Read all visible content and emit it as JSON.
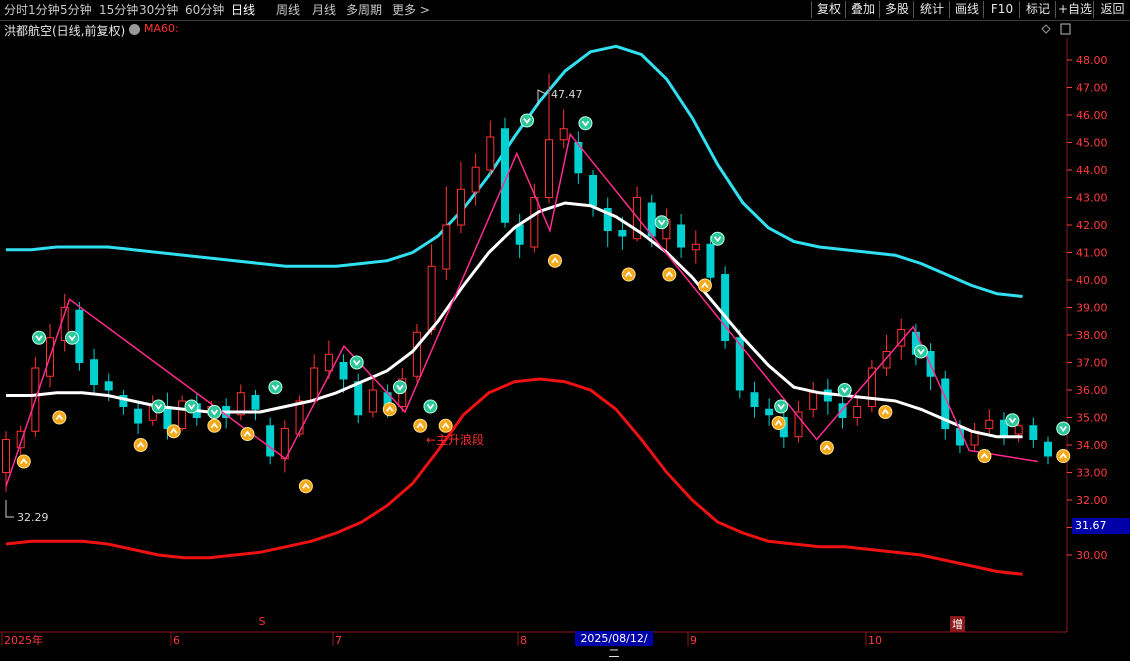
{
  "toolbar": {
    "periods": [
      "分时",
      "1分钟",
      "5分钟",
      "15分钟",
      "30分钟",
      "60分钟",
      "日线",
      "周线",
      "月线",
      "多周期",
      "更多 >"
    ],
    "active_period": "日线",
    "actions": [
      "复权",
      "叠加",
      "多股",
      "统计",
      "画线",
      "F10",
      "标记",
      "+自选",
      "返回"
    ]
  },
  "info": {
    "title": "洪都航空(日线,前复权)",
    "indicator": "MA60:"
  },
  "colors": {
    "up": "#ff3232",
    "down": "#00d0d0",
    "upper_band": "#30e0f0",
    "lower_band": "#ee1111",
    "mid_line": "#ffffff",
    "zigzag": "#ff2b8e",
    "axis_text": "#ff3c3c",
    "grid": "#8b1a1a"
  },
  "chart_data": {
    "type": "candlestick",
    "y_axis_ticks": [
      48.0,
      47.0,
      46.0,
      45.0,
      44.0,
      43.0,
      42.0,
      41.0,
      40.0,
      39.0,
      38.0,
      37.0,
      36.0,
      35.0,
      34.0,
      33.0,
      32.0,
      31.0,
      30.0
    ],
    "ylim": [
      29.5,
      49.0
    ],
    "x_axis_labels": [
      "2025年",
      "6",
      "7",
      "8",
      "9",
      "10"
    ],
    "high_label": "47.47",
    "low_label": "32.29",
    "current_price": "31.67",
    "cursor_date": "2025/08/12/二",
    "annotation": "←主升浪段",
    "marker_s": "S",
    "badge_zeng": "增",
    "upper_band": [
      41.1,
      41.1,
      41.2,
      41.2,
      41.2,
      41.1,
      41.0,
      40.9,
      40.8,
      40.7,
      40.6,
      40.5,
      40.5,
      40.5,
      40.6,
      40.7,
      41.0,
      41.6,
      42.6,
      43.8,
      45.2,
      46.5,
      47.6,
      48.3,
      48.5,
      48.2,
      47.3,
      45.9,
      44.2,
      42.8,
      41.9,
      41.4,
      41.2,
      41.1,
      41.0,
      40.9,
      40.6,
      40.2,
      39.8,
      39.5,
      39.4
    ],
    "mid_line": [
      35.8,
      35.8,
      35.9,
      35.9,
      35.8,
      35.6,
      35.4,
      35.3,
      35.2,
      35.2,
      35.2,
      35.4,
      35.6,
      35.9,
      36.3,
      36.7,
      37.4,
      38.5,
      39.8,
      41.0,
      41.9,
      42.5,
      42.8,
      42.7,
      42.3,
      41.7,
      41.0,
      40.1,
      39.0,
      37.9,
      36.9,
      36.1,
      35.9,
      35.8,
      35.7,
      35.6,
      35.3,
      34.9,
      34.5,
      34.3,
      34.3
    ],
    "lower_band": [
      30.4,
      30.5,
      30.5,
      30.5,
      30.4,
      30.2,
      30.0,
      29.9,
      29.9,
      30.0,
      30.1,
      30.3,
      30.5,
      30.8,
      31.2,
      31.8,
      32.6,
      33.8,
      35.1,
      35.9,
      36.3,
      36.4,
      36.3,
      36.0,
      35.3,
      34.2,
      33.0,
      32.0,
      31.2,
      30.8,
      30.5,
      30.4,
      30.3,
      30.3,
      30.2,
      30.1,
      30.0,
      29.8,
      29.6,
      29.4,
      29.3
    ],
    "zigzag": [
      [
        0,
        32.5
      ],
      [
        2.5,
        39.3
      ],
      [
        11.0,
        33.5
      ],
      [
        13.3,
        37.6
      ],
      [
        15.7,
        35.2
      ],
      [
        20.1,
        44.6
      ],
      [
        21.4,
        41.8
      ],
      [
        22.2,
        45.3
      ],
      [
        31.9,
        34.2
      ],
      [
        35.7,
        38.3
      ],
      [
        37.9,
        33.8
      ],
      [
        40.6,
        33.4
      ]
    ],
    "sell_markers": [
      [
        1.3,
        37.9
      ],
      [
        2.6,
        37.9
      ],
      [
        6.0,
        35.4
      ],
      [
        7.3,
        35.4
      ],
      [
        8.2,
        35.2
      ],
      [
        10.6,
        36.1
      ],
      [
        13.8,
        37.0
      ],
      [
        15.5,
        36.1
      ],
      [
        16.7,
        35.4
      ],
      [
        20.5,
        45.8
      ],
      [
        22.8,
        45.7
      ],
      [
        25.8,
        42.1
      ],
      [
        28.0,
        41.5
      ],
      [
        30.5,
        35.4
      ],
      [
        33.0,
        36.0
      ],
      [
        36.0,
        37.4
      ],
      [
        39.6,
        34.9
      ],
      [
        41.6,
        34.6
      ]
    ],
    "buy_markers": [
      [
        0.7,
        33.4
      ],
      [
        2.1,
        35.0
      ],
      [
        5.3,
        34.0
      ],
      [
        6.6,
        34.5
      ],
      [
        8.2,
        34.7
      ],
      [
        9.5,
        34.4
      ],
      [
        11.8,
        32.5
      ],
      [
        15.1,
        35.3
      ],
      [
        16.3,
        34.7
      ],
      [
        17.3,
        34.7
      ],
      [
        21.6,
        40.7
      ],
      [
        24.5,
        40.2
      ],
      [
        26.1,
        40.2
      ],
      [
        27.5,
        39.8
      ],
      [
        30.4,
        34.8
      ],
      [
        32.3,
        33.9
      ],
      [
        34.6,
        35.2
      ],
      [
        38.5,
        33.6
      ],
      [
        41.6,
        33.6
      ]
    ],
    "candles": [
      [
        33.0,
        34.2,
        34.5,
        32.3
      ],
      [
        33.9,
        34.5,
        34.7,
        33.6
      ],
      [
        34.5,
        36.8,
        37.2,
        34.3
      ],
      [
        36.5,
        37.9,
        38.4,
        36.1
      ],
      [
        37.8,
        39.0,
        39.5,
        37.4
      ],
      [
        38.9,
        37.0,
        39.2,
        36.7
      ],
      [
        37.1,
        36.2,
        37.5,
        35.9
      ],
      [
        36.3,
        36.0,
        36.6,
        35.6
      ],
      [
        35.8,
        35.4,
        36.0,
        35.1
      ],
      [
        35.3,
        34.8,
        35.6,
        34.4
      ],
      [
        34.9,
        35.5,
        35.8,
        34.7
      ],
      [
        35.4,
        34.6,
        35.9,
        34.2
      ],
      [
        34.6,
        35.6,
        35.8,
        34.5
      ],
      [
        35.5,
        35.0,
        35.9,
        34.7
      ],
      [
        35.1,
        35.4,
        35.6,
        34.8
      ],
      [
        35.4,
        35.0,
        35.7,
        34.6
      ],
      [
        35.1,
        35.9,
        36.2,
        34.9
      ],
      [
        35.8,
        35.3,
        36.0,
        34.9
      ],
      [
        34.7,
        33.6,
        35.0,
        33.3
      ],
      [
        33.5,
        34.6,
        34.9,
        33.0
      ],
      [
        34.4,
        35.6,
        35.8,
        34.3
      ],
      [
        35.6,
        36.8,
        37.3,
        35.5
      ],
      [
        36.7,
        37.3,
        37.8,
        36.4
      ],
      [
        37.0,
        36.4,
        37.3,
        35.9
      ],
      [
        36.3,
        35.1,
        36.6,
        34.8
      ],
      [
        35.2,
        36.0,
        36.5,
        35.0
      ],
      [
        35.9,
        35.3,
        36.2,
        35.0
      ],
      [
        35.4,
        36.4,
        36.8,
        35.2
      ],
      [
        36.5,
        38.1,
        38.4,
        36.3
      ],
      [
        38.2,
        40.5,
        41.3,
        38.0
      ],
      [
        40.4,
        42.0,
        43.4,
        40.0
      ],
      [
        42.0,
        43.3,
        44.3,
        41.7
      ],
      [
        43.2,
        44.1,
        44.6,
        42.7
      ],
      [
        44.0,
        45.2,
        45.8,
        43.8
      ],
      [
        45.5,
        42.1,
        45.9,
        41.9
      ],
      [
        42.0,
        41.3,
        42.4,
        40.8
      ],
      [
        41.2,
        43.0,
        43.5,
        41.0
      ],
      [
        43.0,
        45.1,
        47.5,
        42.8
      ],
      [
        45.1,
        45.5,
        46.2,
        44.8
      ],
      [
        45.0,
        43.9,
        45.4,
        43.5
      ],
      [
        43.8,
        42.7,
        44.0,
        42.3
      ],
      [
        42.6,
        41.8,
        43.0,
        41.2
      ],
      [
        41.8,
        41.6,
        42.3,
        41.1
      ],
      [
        41.5,
        43.0,
        43.4,
        41.4
      ],
      [
        42.8,
        41.6,
        43.1,
        41.2
      ],
      [
        41.5,
        42.2,
        42.6,
        41.0
      ],
      [
        42.0,
        41.2,
        42.4,
        40.8
      ],
      [
        41.1,
        41.3,
        41.8,
        40.6
      ],
      [
        41.3,
        40.1,
        41.6,
        39.8
      ],
      [
        40.2,
        37.8,
        40.5,
        37.5
      ],
      [
        37.9,
        36.0,
        38.2,
        35.7
      ],
      [
        35.9,
        35.4,
        36.3,
        35.0
      ],
      [
        35.3,
        35.1,
        35.7,
        34.7
      ],
      [
        35.0,
        34.3,
        35.4,
        33.9
      ],
      [
        34.3,
        35.2,
        35.6,
        34.1
      ],
      [
        35.3,
        35.9,
        36.3,
        35.0
      ],
      [
        36.0,
        35.6,
        36.4,
        35.1
      ],
      [
        35.5,
        35.0,
        35.9,
        34.6
      ],
      [
        35.0,
        35.4,
        35.8,
        34.7
      ],
      [
        35.4,
        36.8,
        37.1,
        35.2
      ],
      [
        36.8,
        37.4,
        38.0,
        36.5
      ],
      [
        37.6,
        38.2,
        38.6,
        37.1
      ],
      [
        38.1,
        37.3,
        38.4,
        36.9
      ],
      [
        37.4,
        36.5,
        37.7,
        36.0
      ],
      [
        36.4,
        34.6,
        36.7,
        34.2
      ],
      [
        34.6,
        34.0,
        34.9,
        33.7
      ],
      [
        34.0,
        34.5,
        34.8,
        33.8
      ],
      [
        34.6,
        34.9,
        35.3,
        34.3
      ],
      [
        34.9,
        34.3,
        35.2,
        34.0
      ],
      [
        34.4,
        34.7,
        35.0,
        34.1
      ],
      [
        34.7,
        34.2,
        35.0,
        33.9
      ],
      [
        34.1,
        33.6,
        34.3,
        33.3
      ]
    ]
  }
}
